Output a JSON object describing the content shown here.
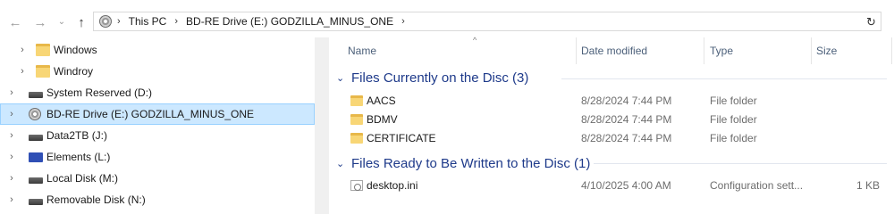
{
  "address": {
    "segments": [
      "This PC",
      "BD-RE Drive (E:) GODZILLA_MINUS_ONE"
    ]
  },
  "nav_pane": {
    "items": [
      {
        "label": "Windows",
        "icon": "folder-icon",
        "indent": 2
      },
      {
        "label": "Windroy",
        "icon": "folder-icon",
        "indent": 2
      },
      {
        "label": "System Reserved (D:)",
        "icon": "drive-icon",
        "indent": 1
      },
      {
        "label": "BD-RE Drive (E:) GODZILLA_MINUS_ONE",
        "icon": "disc-drive-icon",
        "indent": 1,
        "selected": true
      },
      {
        "label": "Data2TB (J:)",
        "icon": "drive-icon",
        "indent": 1
      },
      {
        "label": "Elements (L:)",
        "icon": "external-drive-icon",
        "indent": 1
      },
      {
        "label": "Local Disk (M:)",
        "icon": "drive-icon",
        "indent": 1
      },
      {
        "label": "Removable Disk (N:)",
        "icon": "drive-icon",
        "indent": 1
      }
    ]
  },
  "columns": {
    "name": "Name",
    "date": "Date modified",
    "type": "Type",
    "size": "Size"
  },
  "groups": [
    {
      "title": "Files Currently on the Disc (3)",
      "rows": [
        {
          "name": "AACS",
          "date": "8/28/2024 7:44 PM",
          "type": "File folder",
          "size": "",
          "icon": "folder-icon"
        },
        {
          "name": "BDMV",
          "date": "8/28/2024 7:44 PM",
          "type": "File folder",
          "size": "",
          "icon": "folder-icon"
        },
        {
          "name": "CERTIFICATE",
          "date": "8/28/2024 7:44 PM",
          "type": "File folder",
          "size": "",
          "icon": "folder-icon"
        }
      ]
    },
    {
      "title": "Files Ready to Be Written to the Disc (1)",
      "rows": [
        {
          "name": "desktop.ini",
          "date": "4/10/2025 4:00 AM",
          "type": "Configuration sett...",
          "size": "1 KB",
          "icon": "settings-file-icon"
        }
      ]
    }
  ],
  "colors": {
    "selection": "#cce8ff",
    "group_header": "#1e3a8a",
    "folder": "#f8d676"
  }
}
